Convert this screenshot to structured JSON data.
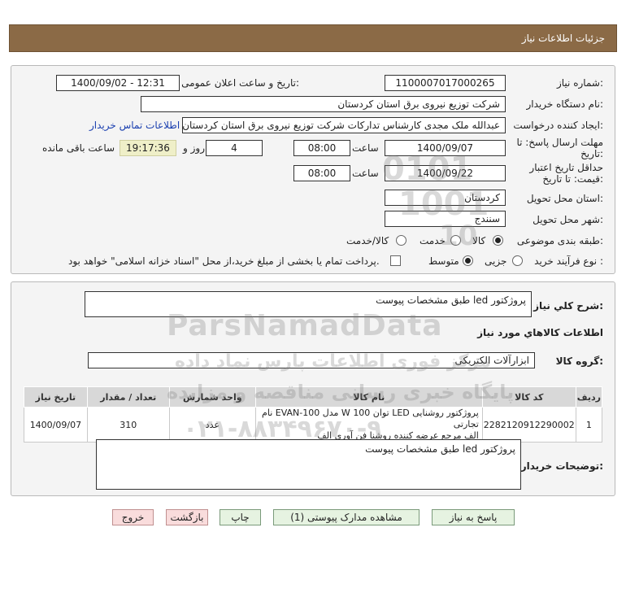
{
  "header": {
    "title": "جزئیات اطلاعات نیاز"
  },
  "form": {
    "need_number_label": "شماره نیاز:",
    "need_number": "1100007017000265",
    "announce_label": "تاریخ و ساعت اعلان عمومی:",
    "announce_value": "1400/09/02 - 12:31",
    "buyer_org_label": "نام دستگاه خریدار:",
    "buyer_org": "شرکت توزیع نیروی برق استان کردستان",
    "creator_label": "ایجاد کننده درخواست:",
    "creator": "عبدالله ملک مجدی کارشناس تدارکات شرکت توزیع نیروی برق استان کردستان",
    "contact_link": "اطلاعات تماس خریدار",
    "deadline_label_1": "مهلت ارسال پاسخ: تا",
    "deadline_label_2": "تاریخ:",
    "deadline_date": "1400/09/07",
    "time_label": "ساعت",
    "deadline_time": "08:00",
    "days_value": "4",
    "days_label": "روز و",
    "remaining_time": "19:17:36",
    "remaining_label": "ساعت باقی مانده",
    "validity_label_1": "حداقل تاریخ اعتبار",
    "validity_label_2": "قیمت: تا تاریخ:",
    "validity_date": "1400/09/22",
    "validity_time_label": "ساعت",
    "validity_time": "08:00",
    "province_label": "استان محل تحویل:",
    "province": "کردستان",
    "city_label": "شهر محل تحویل:",
    "city": "سنندج",
    "category_label": "طبقه بندی موضوعی:",
    "category_options": [
      "کالا",
      "خدمت",
      "کالا/خدمت"
    ],
    "category_selected": "کالا",
    "process_label": "نوع فرآیند خرید :",
    "process_options": [
      "جزیی",
      "متوسط"
    ],
    "process_selected": "متوسط",
    "payment_note": "پرداخت تمام یا بخشی از مبلغ خرید،از محل \"اسناد خزانه اسلامی\" خواهد بود."
  },
  "details": {
    "summary_label": "شرح کلي نياز:",
    "summary": "پروژکتور led طبق مشخصات پیوست",
    "goods_info_title": "اطلاعات کالاهاي مورد نياز",
    "goods_group_label": "گروه کالا:",
    "goods_group": "ابزارآلات الکتریکی",
    "table_headers": [
      "ردیف",
      "کد کالا",
      "نام کالا",
      "واحد شمارش",
      "تعداد / مقدار",
      "تاریخ نیاز"
    ],
    "rows": [
      {
        "row": "1",
        "code": "2282120912290002",
        "name_line1": "پروژکتور روشنایی LED توان 100 W مدل EVAN-100 نام تجارتی",
        "name_line2": "الف مرجع عرضه کننده روشنا فن آوری الف",
        "unit": "عدد",
        "qty": "310",
        "date": "1400/09/07"
      }
    ],
    "buyer_desc_label": "توضیحات خریدار:",
    "buyer_desc": "پروژکتور led طبق مشخصات پیوست"
  },
  "buttons": {
    "reply": "پاسخ به نیاز",
    "attachments": "مشاهده مدارک پیوستی (1)",
    "print": "چاپ",
    "back": "بازگشت",
    "exit": "خروج"
  },
  "watermark": {
    "brand": "ParsNamadData",
    "line1": "مرکز فوری اطلاعات پارس نماد داده",
    "line2": "پایگاه خبری رسانی مناقصه و مزایده",
    "phone": "۰۲۱-۸۸۳۴۹۶۷۰-۹",
    "stamp_top": "0101",
    "stamp_mid": "1001",
    "stamp_bot": "10"
  },
  "colors": {
    "title_bar": "#8b6a46",
    "panel_bg": "#f4f4f4",
    "button_green": "#e6f3e1",
    "button_red": "#f9dcdc",
    "link": "#1a3faf"
  }
}
